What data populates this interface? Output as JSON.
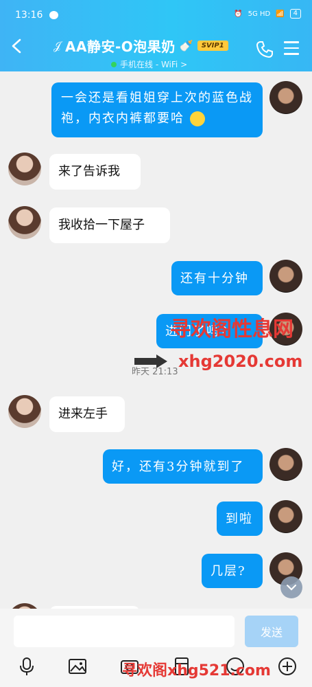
{
  "status": {
    "time": "13:16",
    "network": "5G HD",
    "battery": "4"
  },
  "header": {
    "title": "AA静安-O泡果奶",
    "vip": "SVIP1",
    "online": "手机在线 - WiFi >"
  },
  "messages": [
    {
      "side": "right",
      "text": "一会还是看姐姐穿上次的蓝色战袍，内衣内裤都要哈"
    },
    {
      "side": "left",
      "text": "来了告诉我"
    },
    {
      "side": "left",
      "text": "我收拾一下屋子"
    },
    {
      "side": "right",
      "text": "还有十分钟"
    },
    {
      "side": "right",
      "text": "进门了吗?"
    },
    {
      "side": "left",
      "text": "进来左手"
    },
    {
      "side": "right",
      "text": "好，还有3分钟就到了"
    },
    {
      "side": "right",
      "text": "到啦"
    },
    {
      "side": "right",
      "text": "几层?"
    }
  ],
  "divider": {
    "time": "昨天 21:13"
  },
  "watermarks": {
    "top": "寻欢阁性息网",
    "mid": "xhg2020.com",
    "bottom": "寻欢阁xhg521.com"
  },
  "input": {
    "placeholder": "",
    "send_label": "发送"
  },
  "tools": [
    "mic-icon",
    "image-icon",
    "camera-icon",
    "red-packet-icon",
    "emoji-icon",
    "plus-icon"
  ]
}
